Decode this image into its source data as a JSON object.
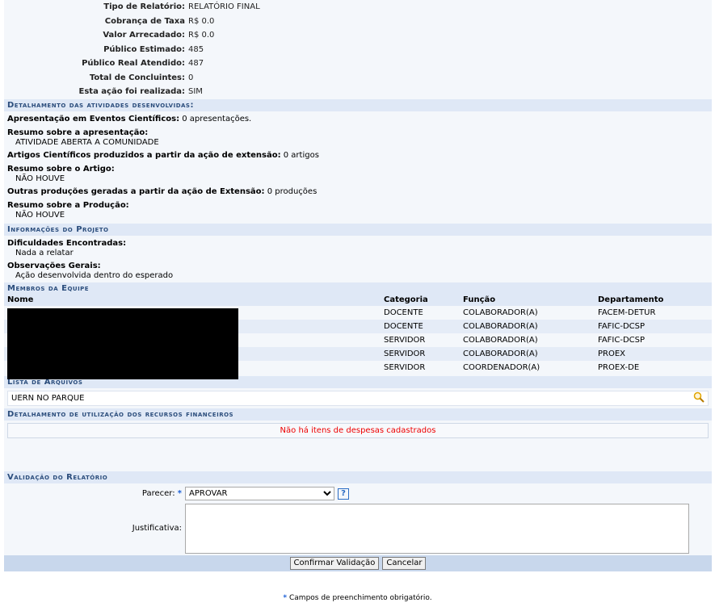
{
  "report": [
    {
      "label": "Tipo de Relatório:",
      "value": "RELATÓRIO FINAL"
    },
    {
      "label": "Cobrança de Taxa",
      "value": "R$ 0.0"
    },
    {
      "label": "Valor Arrecadado:",
      "value": "R$ 0.0"
    },
    {
      "label": "Público Estimado:",
      "value": "485"
    },
    {
      "label": "Público Real Atendido:",
      "value": "487"
    },
    {
      "label": "Total de Concluintes:",
      "value": "0"
    },
    {
      "label": "Esta ação foi realizada:",
      "value": "SIM"
    }
  ],
  "activities": {
    "header": "Detalhamento das atividades desenvolvidas:",
    "events_label": "Apresentação em Eventos Científicos:",
    "events_value": "0 apresentações.",
    "summary_pres_label": "Resumo sobre a apresentação:",
    "summary_pres_value": "ATIVIDADE ABERTA A COMUNIDADE",
    "articles_label": "Artigos Científicos produzidos a partir da ação de extensão:",
    "articles_value": "0 artigos",
    "summary_art_label": "Resumo sobre o Artigo:",
    "summary_art_value": "NÃO HOUVE",
    "others_label": "Outras produções geradas a partir da ação de Extensão:",
    "others_value": "0 produções",
    "summary_prod_label": "Resumo sobre a Produção:",
    "summary_prod_value": "NÃO HOUVE"
  },
  "project": {
    "header": "Informações do Projeto",
    "difficulties_label": "Dificuldades Encontradas:",
    "difficulties_value": "Nada a relatar",
    "observations_label": "Observações Gerais:",
    "observations_value": "Ação desenvolvida dentro do esperado"
  },
  "team": {
    "header": "Membros da Equipe",
    "columns": [
      "Nome",
      "Categoria",
      "Função",
      "Departamento"
    ],
    "rows": [
      {
        "categoria": "DOCENTE",
        "funcao": "COLABORADOR(A)",
        "departamento": "FACEM-DETUR"
      },
      {
        "categoria": "DOCENTE",
        "funcao": "COLABORADOR(A)",
        "departamento": "FAFIC-DCSP"
      },
      {
        "categoria": "SERVIDOR",
        "funcao": "COLABORADOR(A)",
        "departamento": "FAFIC-DCSP"
      },
      {
        "categoria": "SERVIDOR",
        "funcao": "COLABORADOR(A)",
        "departamento": "PROEX"
      },
      {
        "categoria": "SERVIDOR",
        "funcao": "COORDENADOR(A)",
        "departamento": "PROEX-DE"
      }
    ]
  },
  "files": {
    "header": "Lista de Arquivos",
    "items": [
      "UERN NO PARQUE"
    ],
    "icon": "magnifier-icon"
  },
  "finance": {
    "header": "Detalhamento de utilização dos recursos financeiros",
    "empty_message": "Não há itens de despesas cadastrados"
  },
  "validation": {
    "header": "Validação do Relatório",
    "parecer_label": "Parecer:",
    "parecer_value": "APROVAR",
    "justificativa_label": "Justificativa:",
    "confirm_button": "Confirmar Validação",
    "cancel_button": "Cancelar",
    "required_note": "Campos de preenchimento obrigatório.",
    "required_mark": "*",
    "help_mark": "?"
  },
  "colors": {
    "section_bg": "#dfe8f6",
    "section_text": "#2b4d7c",
    "error_text": "#e00000",
    "required": "#1a5fd6"
  }
}
